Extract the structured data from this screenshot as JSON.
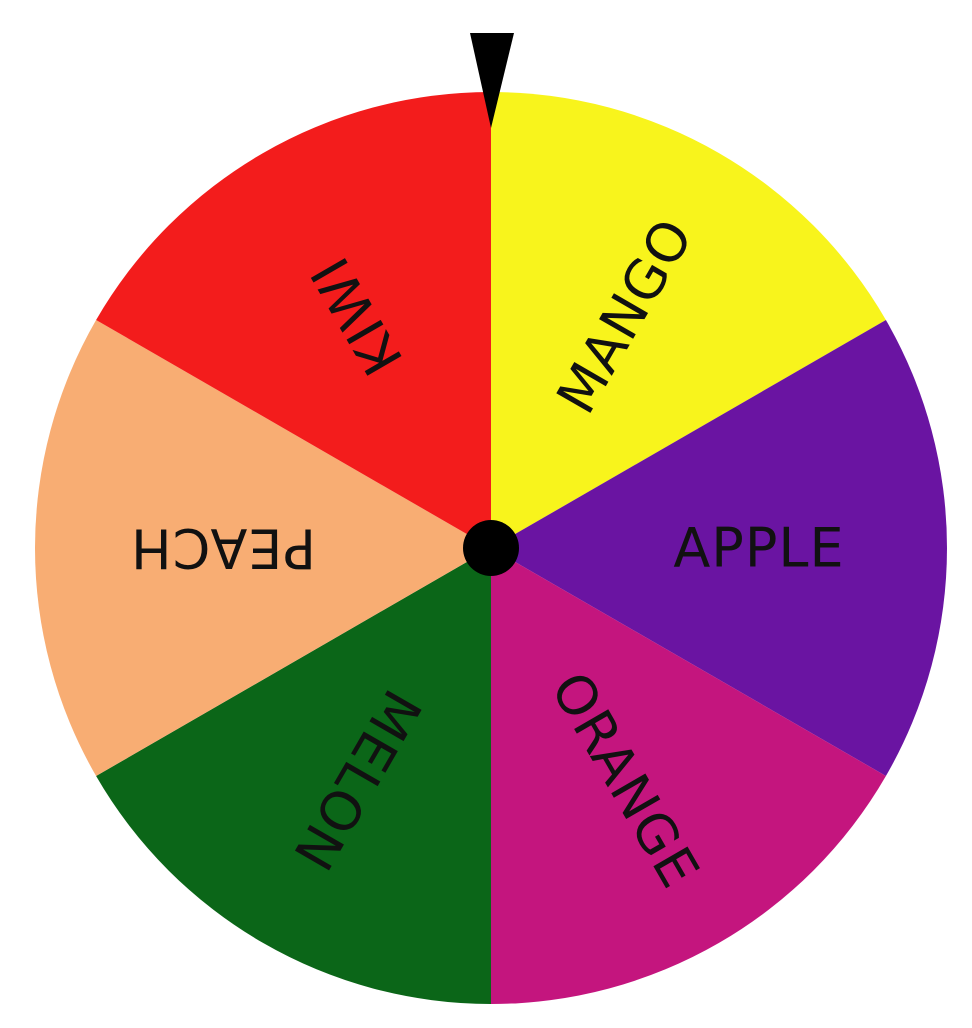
{
  "wheel": {
    "segments": [
      {
        "label": "MANGO",
        "color": "#f8f41c"
      },
      {
        "label": "APPLE",
        "color": "#6a14a2"
      },
      {
        "label": "ORANGE",
        "color": "#c4157e"
      },
      {
        "label": "MELON",
        "color": "#0b6618"
      },
      {
        "label": "PEACH",
        "color": "#f8ad73"
      },
      {
        "label": "KIWI",
        "color": "#f31c1c"
      }
    ],
    "pointer_color": "#000000",
    "hub_color": "#000000"
  }
}
